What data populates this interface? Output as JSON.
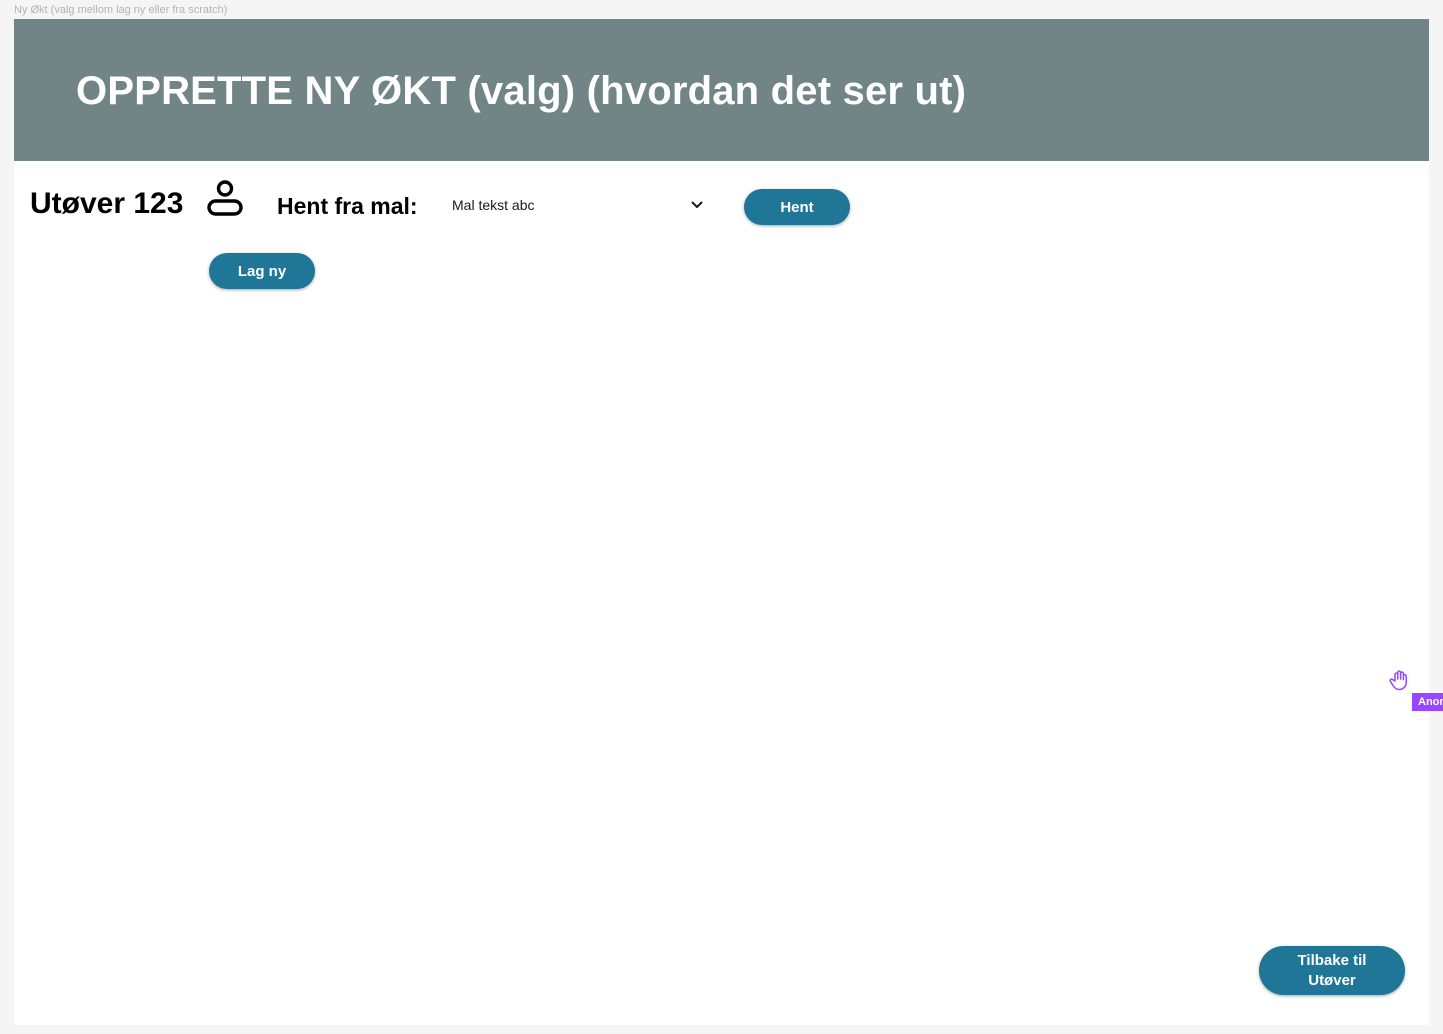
{
  "canvas": {
    "frame_label": "Ny Økt (valg mellom lag ny eller fra scratch)"
  },
  "header": {
    "title": "OPPRETTE NY ØKT (valg) (hvordan det ser ut)",
    "background_color": "#718486"
  },
  "athlete": {
    "name": "Utøver 123",
    "icon": "user-icon"
  },
  "template": {
    "label": "Hent fra mal:",
    "selected_value": "Mal tekst abc",
    "fetch_button_label": "Hent"
  },
  "actions": {
    "create_new_label": "Lag ny",
    "back_label": "Tilbake til Utøver",
    "button_color": "#207696"
  },
  "collaborator": {
    "tag_label": "Anonymous",
    "tag_color": "#9747ff",
    "cursor_icon": "hand-cursor-icon"
  }
}
